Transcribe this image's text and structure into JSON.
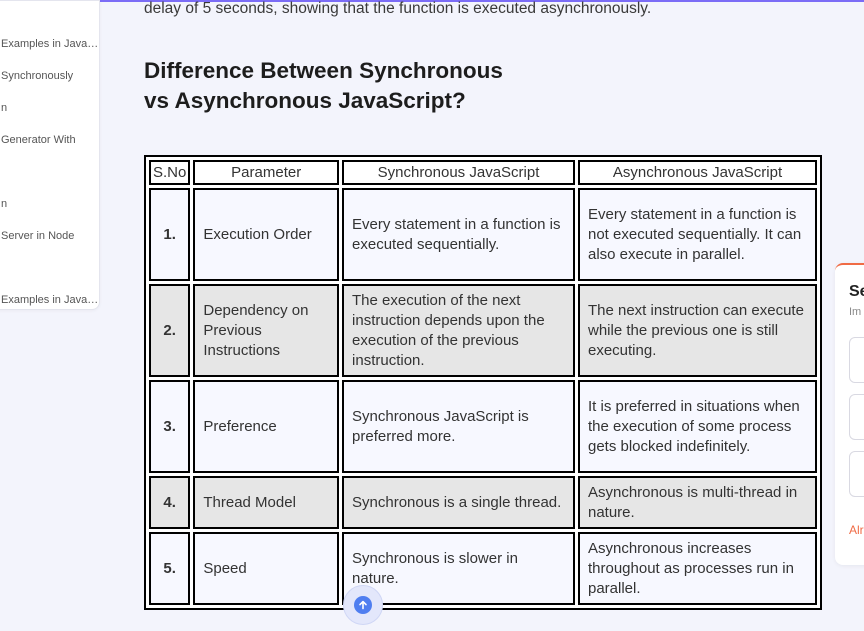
{
  "toc": {
    "items": [
      "Examples in JavaScript",
      "Synchronously",
      "n",
      "Generator With",
      "n",
      "Server in Node",
      "Examples in JavaScript"
    ]
  },
  "article": {
    "intro": "delay of 5 seconds, showing that the function is executed asynchronously.",
    "heading_line1": "Difference Between Synchronous",
    "heading_line2": "vs Asynchronous JavaScript?",
    "table": {
      "headers": [
        "S.No",
        "Parameter",
        "Synchronous JavaScript",
        "Asynchronous JavaScript"
      ],
      "rows": [
        {
          "no": "1.",
          "param": "Execution Order",
          "sync": "Every statement in a function is executed sequentially.",
          "async": "Every statement in a function is not executed sequentially. It can also execute in parallel."
        },
        {
          "no": "2.",
          "param": "Dependency on Previous Instructions",
          "sync": "The execution of the next instruction depends upon the execution of the previous instruction.",
          "async": "The next instruction can execute while the previous one is still executing."
        },
        {
          "no": "3.",
          "param": "Preference",
          "sync": "Synchronous JavaScript is preferred more.",
          "async": "It is preferred in situations when the execution of some process gets blocked indefinitely."
        },
        {
          "no": "4.",
          "param": "Thread Model",
          "sync": "Synchronous is a single thread.",
          "async": "Asynchronous is multi-thread in nature."
        },
        {
          "no": "5.",
          "param": "Speed",
          "sync": "Synchronous is slower in nature.",
          "async": "Asynchronous increases throughout as processes run in parallel."
        }
      ]
    }
  },
  "side_card": {
    "title": "Se",
    "subtitle": "Im",
    "link": "Alr"
  },
  "colors": {
    "accent": "#7b6cf6",
    "link_orange": "#f06b45",
    "scroll_button": "#4f7ef0"
  },
  "icons": {
    "scroll_top": "arrow-up-icon"
  }
}
